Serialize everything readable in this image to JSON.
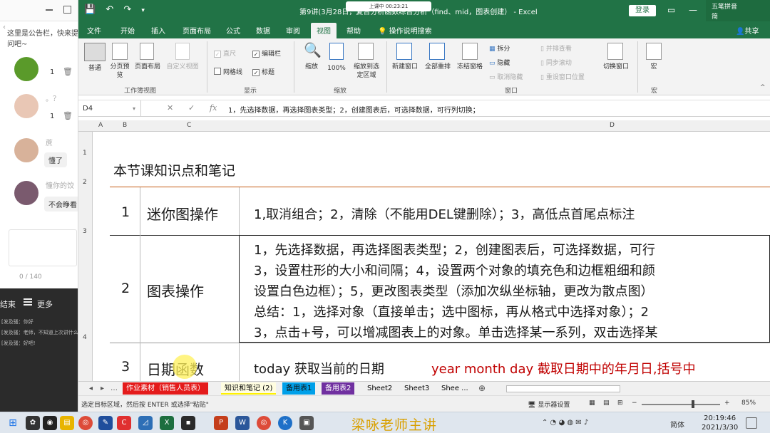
{
  "left_panel": {
    "notice": "这里是公告栏，快来提问吧~",
    "messages": [
      {
        "count": "1"
      },
      {
        "name": "。？",
        "count": "1"
      },
      {
        "name": "蔗",
        "bubble": "懂了"
      },
      {
        "name": "憧你的饺",
        "bubble": "不会睁看"
      }
    ],
    "char_counter": "0 / 140",
    "bottom_bar": {
      "end_label": "结束",
      "more_label": "更多"
    },
    "chat_lines": [
      "[发及骚：你好",
      "[发及骚：老师，不知道上次讲什么",
      "[发及骚：好吧!"
    ]
  },
  "excel": {
    "title": "第9讲(3月28日，复合分析函数综合分析（find、mid，图表创建） - Excel",
    "recording": "上课中 00:23:21",
    "login_label": "登录",
    "ime": {
      "name": "五笔拼音",
      "sub": "简"
    },
    "share_label": "共享",
    "tabs": [
      "文件",
      "开始",
      "插入",
      "页面布局",
      "公式",
      "数据",
      "审阅",
      "视图",
      "帮助",
      "操作说明搜索"
    ],
    "active_tab": "视图",
    "ribbon": {
      "workbook_views": {
        "group": "工作簿视图",
        "normal": "普通",
        "page_break": "分页预览",
        "page_layout": "页面布局",
        "custom": "自定义视图"
      },
      "show": {
        "group": "显示",
        "ruler": "直尺",
        "formula_bar": "编辑栏",
        "gridlines": "网格线",
        "headings": "标题"
      },
      "zoom": {
        "group": "缩放",
        "zoom": "缩放",
        "zoom100": "100%",
        "zoom_sel": "缩放到选定区域"
      },
      "window": {
        "group": "窗口",
        "new_window": "新建窗口",
        "arrange_all": "全部重排",
        "freeze": "冻结窗格",
        "split": "拆分",
        "hide": "隐藏",
        "unhide": "取消隐藏",
        "side_by_side": "并排查看",
        "sync_scroll": "同步滚动",
        "reset_pos": "重设窗口位置",
        "switch": "切换窗口"
      },
      "macros": {
        "group": "宏",
        "macros": "宏"
      }
    },
    "name_box": "D4",
    "formula": "1，先选择数据，再选择图表类型；2，创建图表后，可选择数据，可行列切换；",
    "columns": [
      "A",
      "B",
      "C",
      "D"
    ],
    "rows": [
      "1",
      "2",
      "3",
      "4"
    ],
    "sheet": {
      "heading": "本节课知识点和笔记",
      "items": [
        {
          "no": "1",
          "topic": "迷你图操作",
          "lines": [
            "1,取消组合；2，清除（不能用DEL键删除）；3，高低点首尾点标注"
          ]
        },
        {
          "no": "2",
          "topic": "图表操作",
          "lines": [
            "1，先选择数据，再选择图表类型；2，创建图表后，可选择数据，可行",
            "3，设置柱形的大小和间隔；4，设置两个对象的填充色和边框粗细和颜",
            "设置白色边框）；5，更改图表类型（添加次纵坐标轴，更改为散点图）",
            "总结：1，选择对象（直接单击；选中图标，再从格式中选择对象）；2",
            "3，点击+号，可以增减图表上的对象。单击选择某一系列，双击选择某"
          ]
        },
        {
          "no": "3",
          "topic": "日期函数",
          "lines": [
            "today 获取当前的日期"
          ],
          "red": "year   month  day  截取日期中的年月日,括号中"
        }
      ]
    },
    "sheet_tabs": [
      {
        "label": "作业素材（销售人员表）",
        "color": "#e41b1b"
      },
      {
        "label": "知识和笔记 (2)",
        "color": "#fff100"
      },
      {
        "label": "备用表1",
        "color": "#00a0e9"
      },
      {
        "label": "备用表2",
        "color": "#7030a0"
      },
      {
        "label": "Sheet2",
        "color": ""
      },
      {
        "label": "Sheet3",
        "color": ""
      },
      {
        "label": "Shee ...",
        "color": ""
      }
    ],
    "status": {
      "left": "选定目标区域，然后按 ENTER 或选择\"粘贴\"",
      "display": "显示器设置",
      "zoom": "85%"
    }
  },
  "taskbar": {
    "brand": "梁咏老师主讲",
    "lang": "简体",
    "time": "20:19:46",
    "date": "2021/3/30"
  }
}
